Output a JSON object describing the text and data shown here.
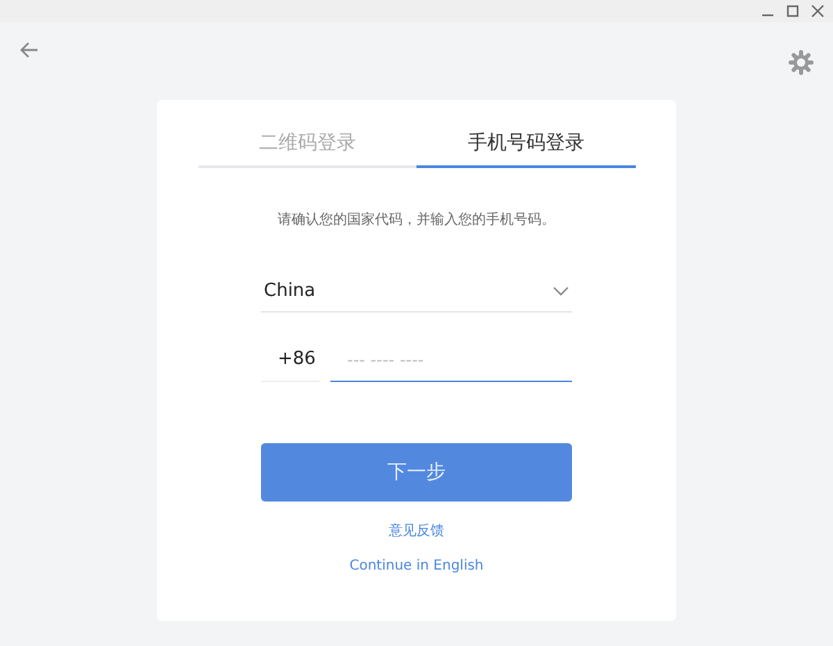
{
  "tabs": [
    {
      "label": "二维码登录",
      "selected": false
    },
    {
      "label": "手机号码登录",
      "selected": true
    }
  ],
  "instruction": "请确认您的国家代码，并输入您的手机号码。",
  "country": {
    "value": "China"
  },
  "phone": {
    "code": "+86",
    "placeholder": "--- ---- ----",
    "focused": true
  },
  "next_button": "下一步",
  "links": [
    "意见反馈",
    "Continue in English"
  ]
}
